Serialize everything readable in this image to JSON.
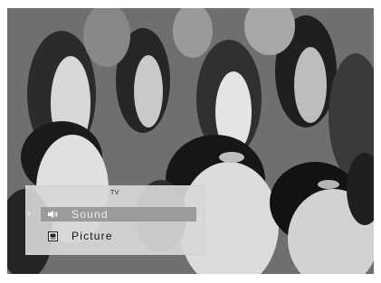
{
  "menu": {
    "title": "TV",
    "cursor": "›",
    "items": [
      {
        "label": "Sound",
        "icon": "speaker-icon",
        "selected": true
      },
      {
        "label": "Picture",
        "icon": "picture-icon",
        "selected": false
      }
    ]
  },
  "colors": {
    "panel": "#d7d7d7",
    "highlight": "#9b9b9b",
    "selected_text": "#eeeeee",
    "text": "#111111"
  }
}
